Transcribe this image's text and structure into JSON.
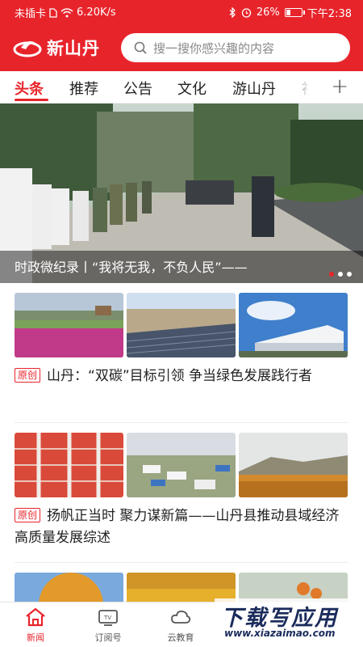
{
  "status_bar": {
    "carrier": "未插卡",
    "speed": "6.20K/s",
    "battery": "26%",
    "battery_level": 0.26,
    "time": "下午2:38"
  },
  "app": {
    "name": "新山丹",
    "search_placeholder": "搜一搜你感兴趣的内容"
  },
  "tabs": [
    {
      "label": "头条",
      "active": true
    },
    {
      "label": "推荐",
      "active": false
    },
    {
      "label": "公告",
      "active": false
    },
    {
      "label": "文化",
      "active": false
    },
    {
      "label": "游山丹",
      "active": false
    },
    {
      "label": "视",
      "active": false
    }
  ],
  "tabs_more_icon": "plus-icon",
  "banner": {
    "caption": "时政微纪录丨“我将无我，不负人民”——",
    "dots": 3,
    "active_dot": 0
  },
  "news": [
    {
      "badge": "原创",
      "title": "山丹：“双碳”目标引领 争当绿色发展践行者"
    },
    {
      "badge": "原创",
      "title": "扬帆正当时 聚力谋新篇——山丹县推动县域经济高质量发展综述"
    }
  ],
  "bottom_nav": [
    {
      "label": "新闻",
      "icon": "home-icon",
      "active": true
    },
    {
      "label": "订阅号",
      "icon": "tv-icon",
      "active": false
    },
    {
      "label": "云教育",
      "icon": "cloud-icon",
      "active": false
    }
  ],
  "watermark": {
    "title": "下载写应用",
    "url": "www.xiazaimao.com"
  },
  "colors": {
    "brand_red": "#e8242b"
  }
}
